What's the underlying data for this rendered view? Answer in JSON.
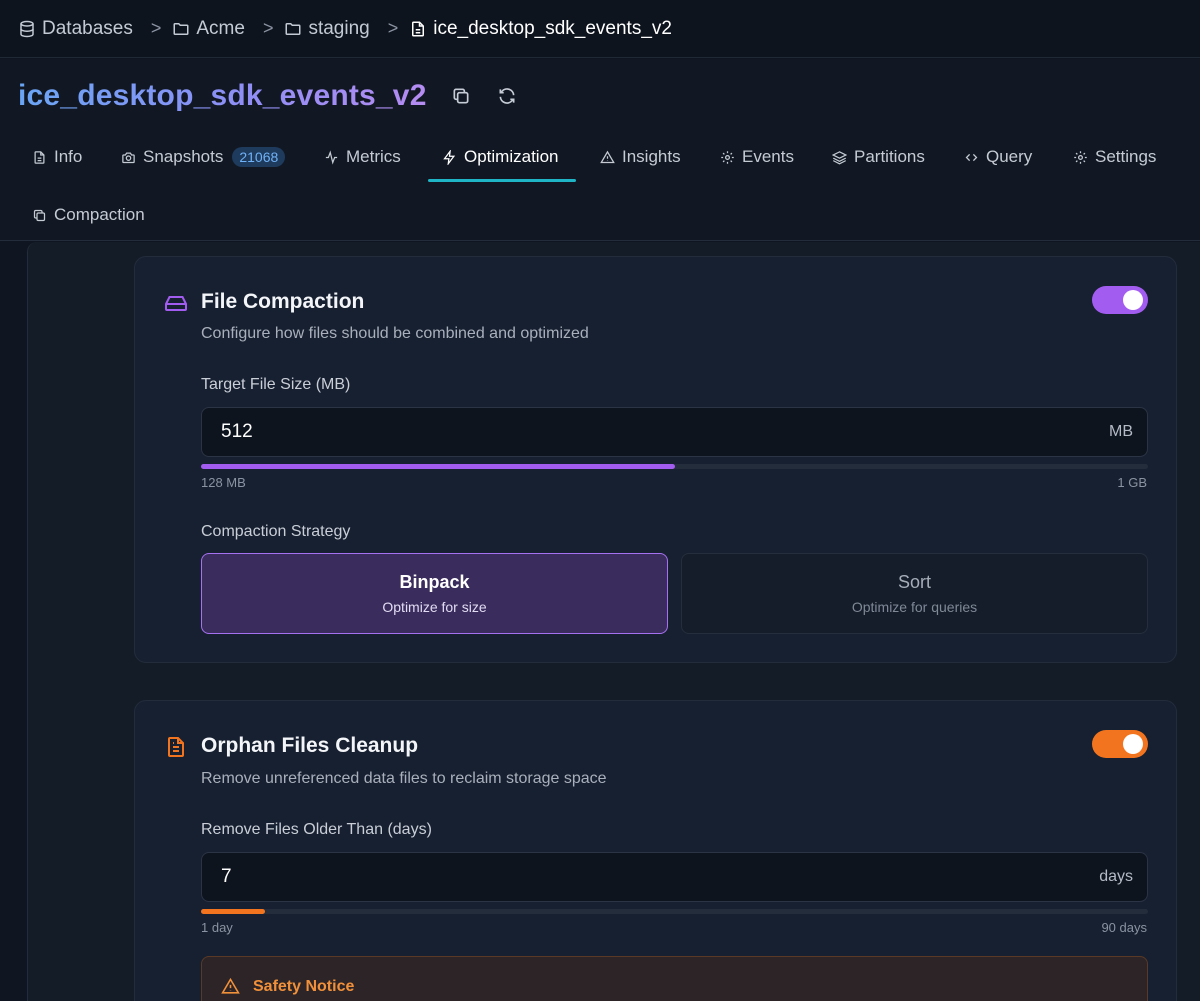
{
  "breadcrumb": {
    "items": [
      {
        "label": "Databases",
        "icon": "database-icon"
      },
      {
        "label": "Acme",
        "icon": "folder-icon"
      },
      {
        "label": "staging",
        "icon": "folder-icon"
      },
      {
        "label": "ice_desktop_sdk_events_v2",
        "icon": "file-icon"
      }
    ],
    "separator": ">"
  },
  "header": {
    "title": "ice_desktop_sdk_events_v2",
    "actions": [
      "copy-icon",
      "refresh-icon"
    ]
  },
  "tabs": [
    {
      "label": "Info",
      "icon": "file-text-icon"
    },
    {
      "label": "Snapshots",
      "icon": "camera-icon",
      "badge": "21068"
    },
    {
      "label": "Metrics",
      "icon": "activity-icon"
    },
    {
      "label": "Optimization",
      "icon": "zap-icon",
      "active": true
    },
    {
      "label": "Insights",
      "icon": "alert-triangle-icon"
    },
    {
      "label": "Events",
      "icon": "gear-icon"
    },
    {
      "label": "Partitions",
      "icon": "layers-icon"
    },
    {
      "label": "Query",
      "icon": "code-icon"
    },
    {
      "label": "Settings",
      "icon": "gear-icon"
    },
    {
      "label": "Compaction",
      "icon": "copy-icon"
    }
  ],
  "file_compaction": {
    "title": "File Compaction",
    "description": "Configure how files should be combined and optimized",
    "enabled": true,
    "accent": "#a35cf0",
    "target_label": "Target File Size (MB)",
    "target_value": "512",
    "target_unit": "MB",
    "slider_fraction": 0.5,
    "range_min": "128 MB",
    "range_max": "1 GB",
    "strategy_label": "Compaction Strategy",
    "strategies": [
      {
        "title": "Binpack",
        "subtitle": "Optimize for size",
        "selected": true
      },
      {
        "title": "Sort",
        "subtitle": "Optimize for queries",
        "selected": false
      }
    ]
  },
  "orphan_cleanup": {
    "title": "Orphan Files Cleanup",
    "description": "Remove unreferenced data files to reclaim storage space",
    "enabled": true,
    "accent": "#f2741f",
    "older_label": "Remove Files Older Than (days)",
    "older_value": "7",
    "older_unit": "days",
    "slider_fraction": 0.0674,
    "range_min": "1 day",
    "range_max": "90 days",
    "notice_title": "Safety Notice"
  }
}
